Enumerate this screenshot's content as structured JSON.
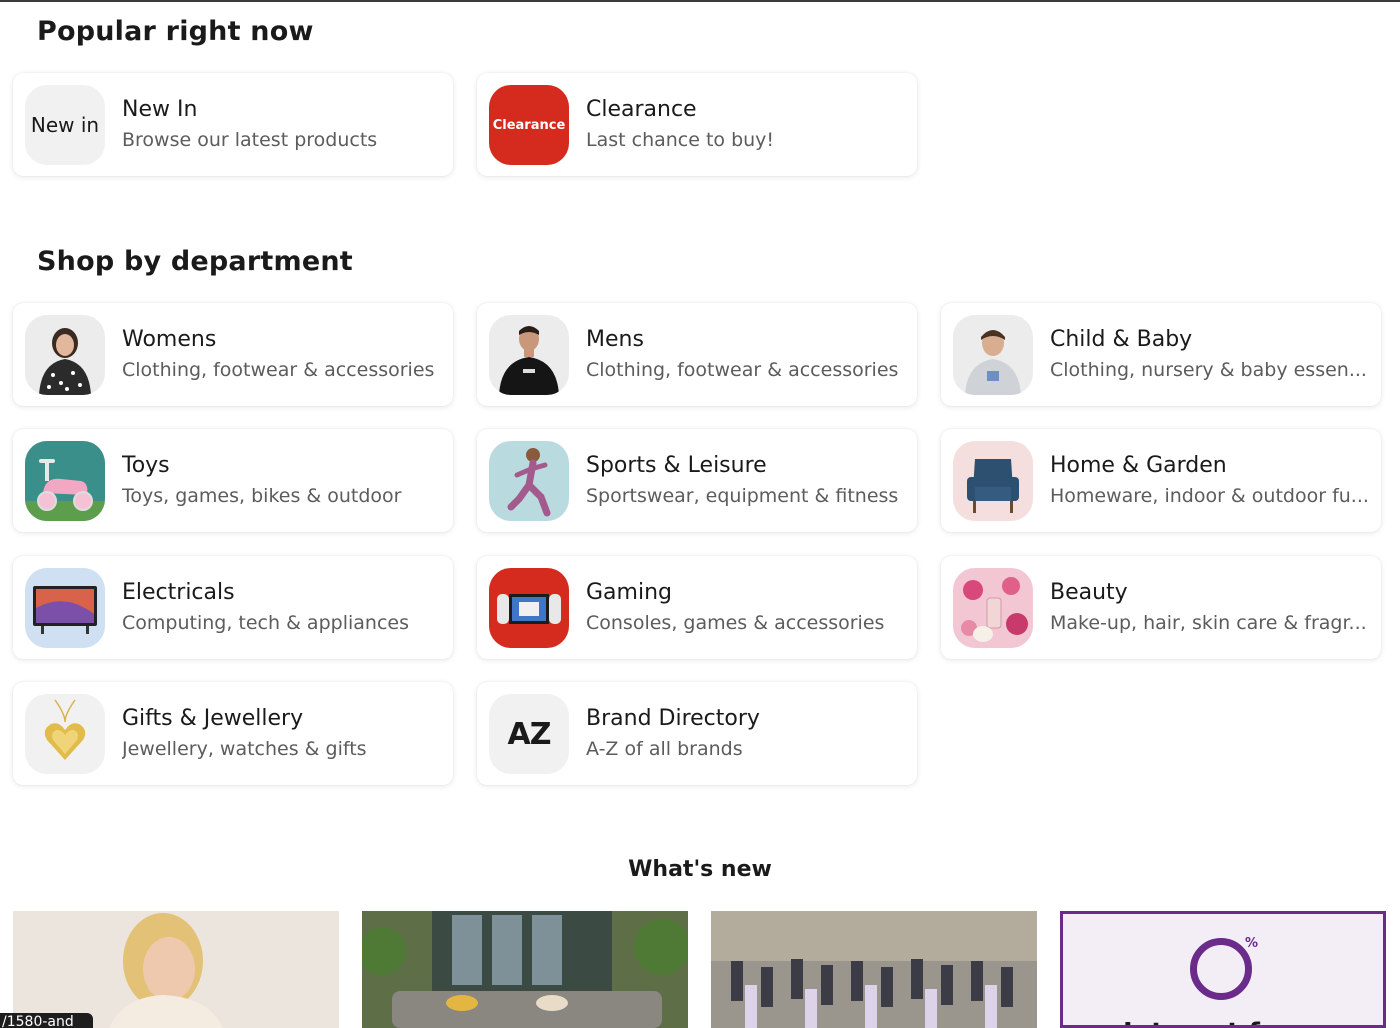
{
  "popular": {
    "title": "Popular right now",
    "items": [
      {
        "thumb_text": "New in",
        "title": "New In",
        "subtitle": "Browse our latest products"
      },
      {
        "thumb_text": "Clearance",
        "title": "Clearance",
        "subtitle": "Last chance to buy!"
      }
    ]
  },
  "departments": {
    "title": "Shop by department",
    "items": [
      {
        "title": "Womens",
        "subtitle": "Clothing, footwear & accessories",
        "icon": "woman-model-icon"
      },
      {
        "title": "Mens",
        "subtitle": "Clothing, footwear & accessories",
        "icon": "man-model-icon"
      },
      {
        "title": "Child & Baby",
        "subtitle": "Clothing, nursery & baby essen...",
        "icon": "child-model-icon"
      },
      {
        "title": "Toys",
        "subtitle": "Toys, games, bikes & outdoor",
        "icon": "toy-bike-icon"
      },
      {
        "title": "Sports & Leisure",
        "subtitle": "Sportswear, equipment & fitness",
        "icon": "runner-icon"
      },
      {
        "title": "Home & Garden",
        "subtitle": "Homeware, indoor & outdoor fu...",
        "icon": "armchair-icon"
      },
      {
        "title": "Electricals",
        "subtitle": "Computing, tech & appliances",
        "icon": "tv-icon"
      },
      {
        "title": "Gaming",
        "subtitle": "Consoles, games & accessories",
        "icon": "game-console-icon"
      },
      {
        "title": "Beauty",
        "subtitle": "Make-up, hair, skin care & fragr...",
        "icon": "flowers-icon"
      },
      {
        "title": "Gifts & Jewellery",
        "subtitle": "Jewellery, watches & gifts",
        "icon": "heart-pendant-icon"
      },
      {
        "title": "Brand Directory",
        "subtitle": "A-Z of all brands",
        "thumb_text": "AZ"
      }
    ]
  },
  "whats_new": {
    "title": "What's new",
    "percent_sign": "%",
    "promo_heading_fragment": "Interest free",
    "url_fragment": "/1580-and"
  },
  "colors": {
    "clearance_red": "#d42b1e",
    "promo_purple": "#6a2b8a"
  }
}
